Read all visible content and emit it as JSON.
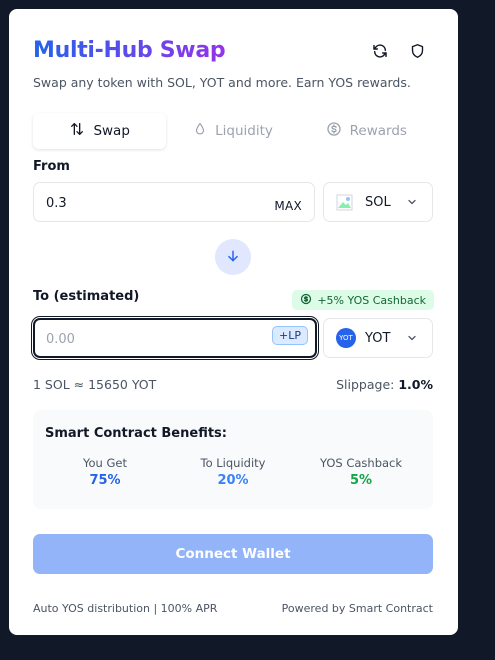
{
  "header": {
    "title": "Multi-Hub Swap",
    "subtitle": "Swap any token with SOL, YOT and more. Earn YOS rewards."
  },
  "tabs": [
    {
      "label": "Swap",
      "icon": "swap-arrows-icon",
      "active": true
    },
    {
      "label": "Liquidity",
      "icon": "droplet-icon",
      "active": false
    },
    {
      "label": "Rewards",
      "icon": "dollar-circle-icon",
      "active": false
    }
  ],
  "from": {
    "label": "From",
    "amount": "0.3",
    "max_label": "MAX",
    "token": "SOL"
  },
  "to": {
    "label": "To (estimated)",
    "placeholder": "0.00",
    "lp_badge": "+LP",
    "token": "YOT",
    "token_icon_text": "YOT",
    "cashback_badge": "+5% YOS Cashback"
  },
  "rate": {
    "text": "1 SOL ≈ 15650 YOT",
    "slippage_label": "Slippage:",
    "slippage_value": "1.0%"
  },
  "benefits": {
    "title": "Smart Contract Benefits:",
    "items": [
      {
        "label": "You Get",
        "value": "75%",
        "color": "#2563eb"
      },
      {
        "label": "To Liquidity",
        "value": "20%",
        "color": "#3b82f6"
      },
      {
        "label": "YOS Cashback",
        "value": "5%",
        "color": "#16a34a"
      }
    ]
  },
  "connect_label": "Connect Wallet",
  "footer": {
    "left": "Auto YOS distribution | 100% APR",
    "right": "Powered by Smart Contract"
  },
  "colors": {
    "background": "#111827",
    "accent": "#2563eb",
    "button_disabled": "#93b4f8",
    "cashback_bg": "#dcfce7"
  }
}
